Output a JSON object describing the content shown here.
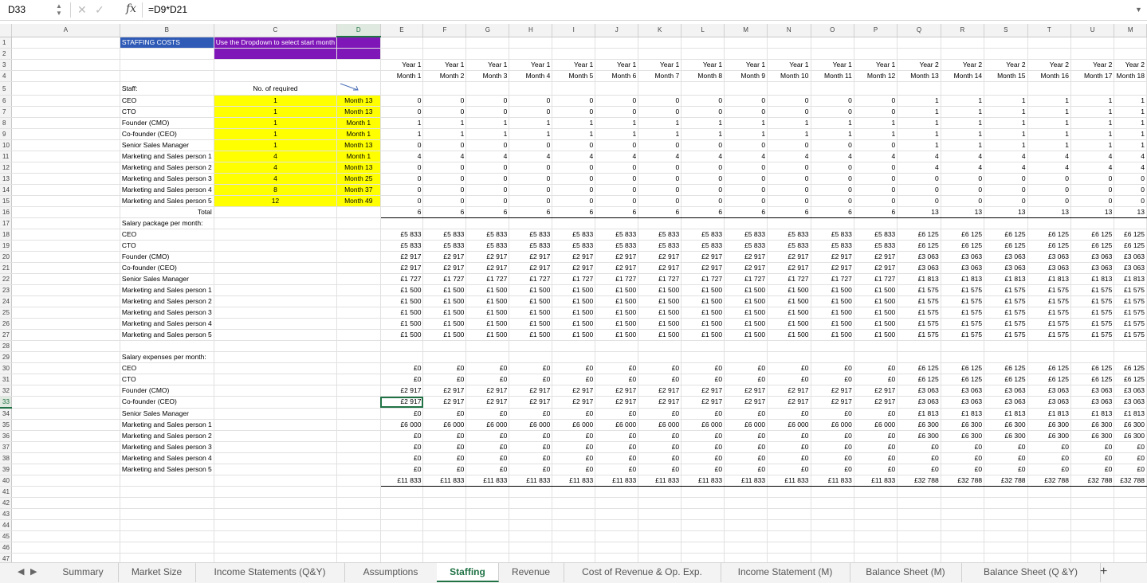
{
  "formula_bar": {
    "cell_ref": "D33",
    "formula": "=D9*D21"
  },
  "columns": [
    "A",
    "B",
    "C",
    "D",
    "E",
    "F",
    "G",
    "H",
    "I",
    "J",
    "K",
    "L",
    "M",
    "N",
    "O",
    "P",
    "Q",
    "R",
    "S",
    "T",
    "U"
  ],
  "col_widths": [
    10,
    150,
    90,
    60,
    56,
    56,
    56,
    56,
    56,
    56,
    56,
    56,
    56,
    56,
    56,
    56,
    56,
    56,
    56,
    56,
    56,
    56
  ],
  "years": [
    "Year 1",
    "Year 1",
    "Year 1",
    "Year 1",
    "Year 1",
    "Year 1",
    "Year 1",
    "Year 1",
    "Year 1",
    "Year 1",
    "Year 1",
    "Year 1",
    "Year 2",
    "Year 2",
    "Year 2",
    "Year 2",
    "Year 2",
    "Year 2"
  ],
  "months": [
    "Month 1",
    "Month 2",
    "Month 3",
    "Month 4",
    "Month 5",
    "Month 6",
    "Month 7",
    "Month 8",
    "Month 9",
    "Month 10",
    "Month 11",
    "Month 12",
    "Month 13",
    "Month 14",
    "Month 15",
    "Month 16",
    "Month 17",
    "Month 18"
  ],
  "text": {
    "title": "STAFFING COSTS",
    "dropdown_hint": "Use the Dropdown to select start month",
    "staff_header": "Staff:",
    "required_header": "No. of required",
    "total_label": "Total",
    "salary_package_header": "Salary package per month:",
    "salary_expenses_header": "Salary expenses per month:",
    "col_v_partial": "M"
  },
  "staff": [
    {
      "role": "CEO",
      "required": "1",
      "start": "Month 13"
    },
    {
      "role": "CTO",
      "required": "1",
      "start": "Month 13"
    },
    {
      "role": "Founder (CMO)",
      "required": "1",
      "start": "Month 1"
    },
    {
      "role": "Co-founder (CEO)",
      "required": "1",
      "start": "Month 1"
    },
    {
      "role": "Senior Sales Manager",
      "required": "1",
      "start": "Month 13"
    },
    {
      "role": "Marketing and Sales person 1",
      "required": "4",
      "start": "Month 1"
    },
    {
      "role": "Marketing and Sales person 2",
      "required": "4",
      "start": "Month 13"
    },
    {
      "role": "Marketing and Sales person 3",
      "required": "4",
      "start": "Month 25"
    },
    {
      "role": "Marketing and Sales person 4",
      "required": "8",
      "start": "Month 37"
    },
    {
      "role": "Marketing and Sales person 5",
      "required": "12",
      "start": "Month 49"
    }
  ],
  "headcount": [
    [
      "0",
      "0",
      "0",
      "0",
      "0",
      "0",
      "0",
      "0",
      "0",
      "0",
      "0",
      "0",
      "1",
      "1",
      "1",
      "1",
      "1",
      "1"
    ],
    [
      "0",
      "0",
      "0",
      "0",
      "0",
      "0",
      "0",
      "0",
      "0",
      "0",
      "0",
      "0",
      "1",
      "1",
      "1",
      "1",
      "1",
      "1"
    ],
    [
      "1",
      "1",
      "1",
      "1",
      "1",
      "1",
      "1",
      "1",
      "1",
      "1",
      "1",
      "1",
      "1",
      "1",
      "1",
      "1",
      "1",
      "1"
    ],
    [
      "1",
      "1",
      "1",
      "1",
      "1",
      "1",
      "1",
      "1",
      "1",
      "1",
      "1",
      "1",
      "1",
      "1",
      "1",
      "1",
      "1",
      "1"
    ],
    [
      "0",
      "0",
      "0",
      "0",
      "0",
      "0",
      "0",
      "0",
      "0",
      "0",
      "0",
      "0",
      "1",
      "1",
      "1",
      "1",
      "1",
      "1"
    ],
    [
      "4",
      "4",
      "4",
      "4",
      "4",
      "4",
      "4",
      "4",
      "4",
      "4",
      "4",
      "4",
      "4",
      "4",
      "4",
      "4",
      "4",
      "4"
    ],
    [
      "0",
      "0",
      "0",
      "0",
      "0",
      "0",
      "0",
      "0",
      "0",
      "0",
      "0",
      "0",
      "4",
      "4",
      "4",
      "4",
      "4",
      "4"
    ],
    [
      "0",
      "0",
      "0",
      "0",
      "0",
      "0",
      "0",
      "0",
      "0",
      "0",
      "0",
      "0",
      "0",
      "0",
      "0",
      "0",
      "0",
      "0"
    ],
    [
      "0",
      "0",
      "0",
      "0",
      "0",
      "0",
      "0",
      "0",
      "0",
      "0",
      "0",
      "0",
      "0",
      "0",
      "0",
      "0",
      "0",
      "0"
    ],
    [
      "0",
      "0",
      "0",
      "0",
      "0",
      "0",
      "0",
      "0",
      "0",
      "0",
      "0",
      "0",
      "0",
      "0",
      "0",
      "0",
      "0",
      "0"
    ]
  ],
  "headcount_total": [
    "6",
    "6",
    "6",
    "6",
    "6",
    "6",
    "6",
    "6",
    "6",
    "6",
    "6",
    "6",
    "13",
    "13",
    "13",
    "13",
    "13",
    "13"
  ],
  "salary_package_y1": [
    "£5 833",
    "£5 833",
    "£2 917",
    "£2 917",
    "£1 727",
    "£1 500",
    "£1 500",
    "£1 500",
    "£1 500",
    "£1 500"
  ],
  "salary_package_y2": [
    "£6 125",
    "£6 125",
    "£3 063",
    "£3 063",
    "£1 813",
    "£1 575",
    "£1 575",
    "£1 575",
    "£1 575",
    "£1 575"
  ],
  "salary_expenses_y1": [
    "£0",
    "£0",
    "£2 917",
    "£2 917",
    "£0",
    "£6 000",
    "£0",
    "£0",
    "£0",
    "£0"
  ],
  "salary_expenses_y2": [
    "£6 125",
    "£6 125",
    "£3 063",
    "£3 063",
    "£1 813",
    "£6 300",
    "£6 300",
    "£0",
    "£0",
    "£0"
  ],
  "salary_expenses_total": [
    "£11 833",
    "£11 833",
    "£11 833",
    "£11 833",
    "£11 833",
    "£11 833",
    "£11 833",
    "£11 833",
    "£11 833",
    "£11 833",
    "£11 833",
    "£11 833",
    "£32 788",
    "£32 788",
    "£32 788",
    "£32 788",
    "£32 788",
    "£32 788"
  ],
  "tabs": [
    "Summary",
    "Market Size",
    "Income  Statements (Q&Y)",
    "Assumptions",
    "Staffing",
    "Revenue",
    "Cost of Revenue & Op. Exp.",
    "Income Statement (M)",
    "Balance Sheet (M)",
    "Balance Sheet (Q &Y)"
  ],
  "active_tab": "Staffing",
  "selected": {
    "row": 33,
    "col": "D"
  }
}
